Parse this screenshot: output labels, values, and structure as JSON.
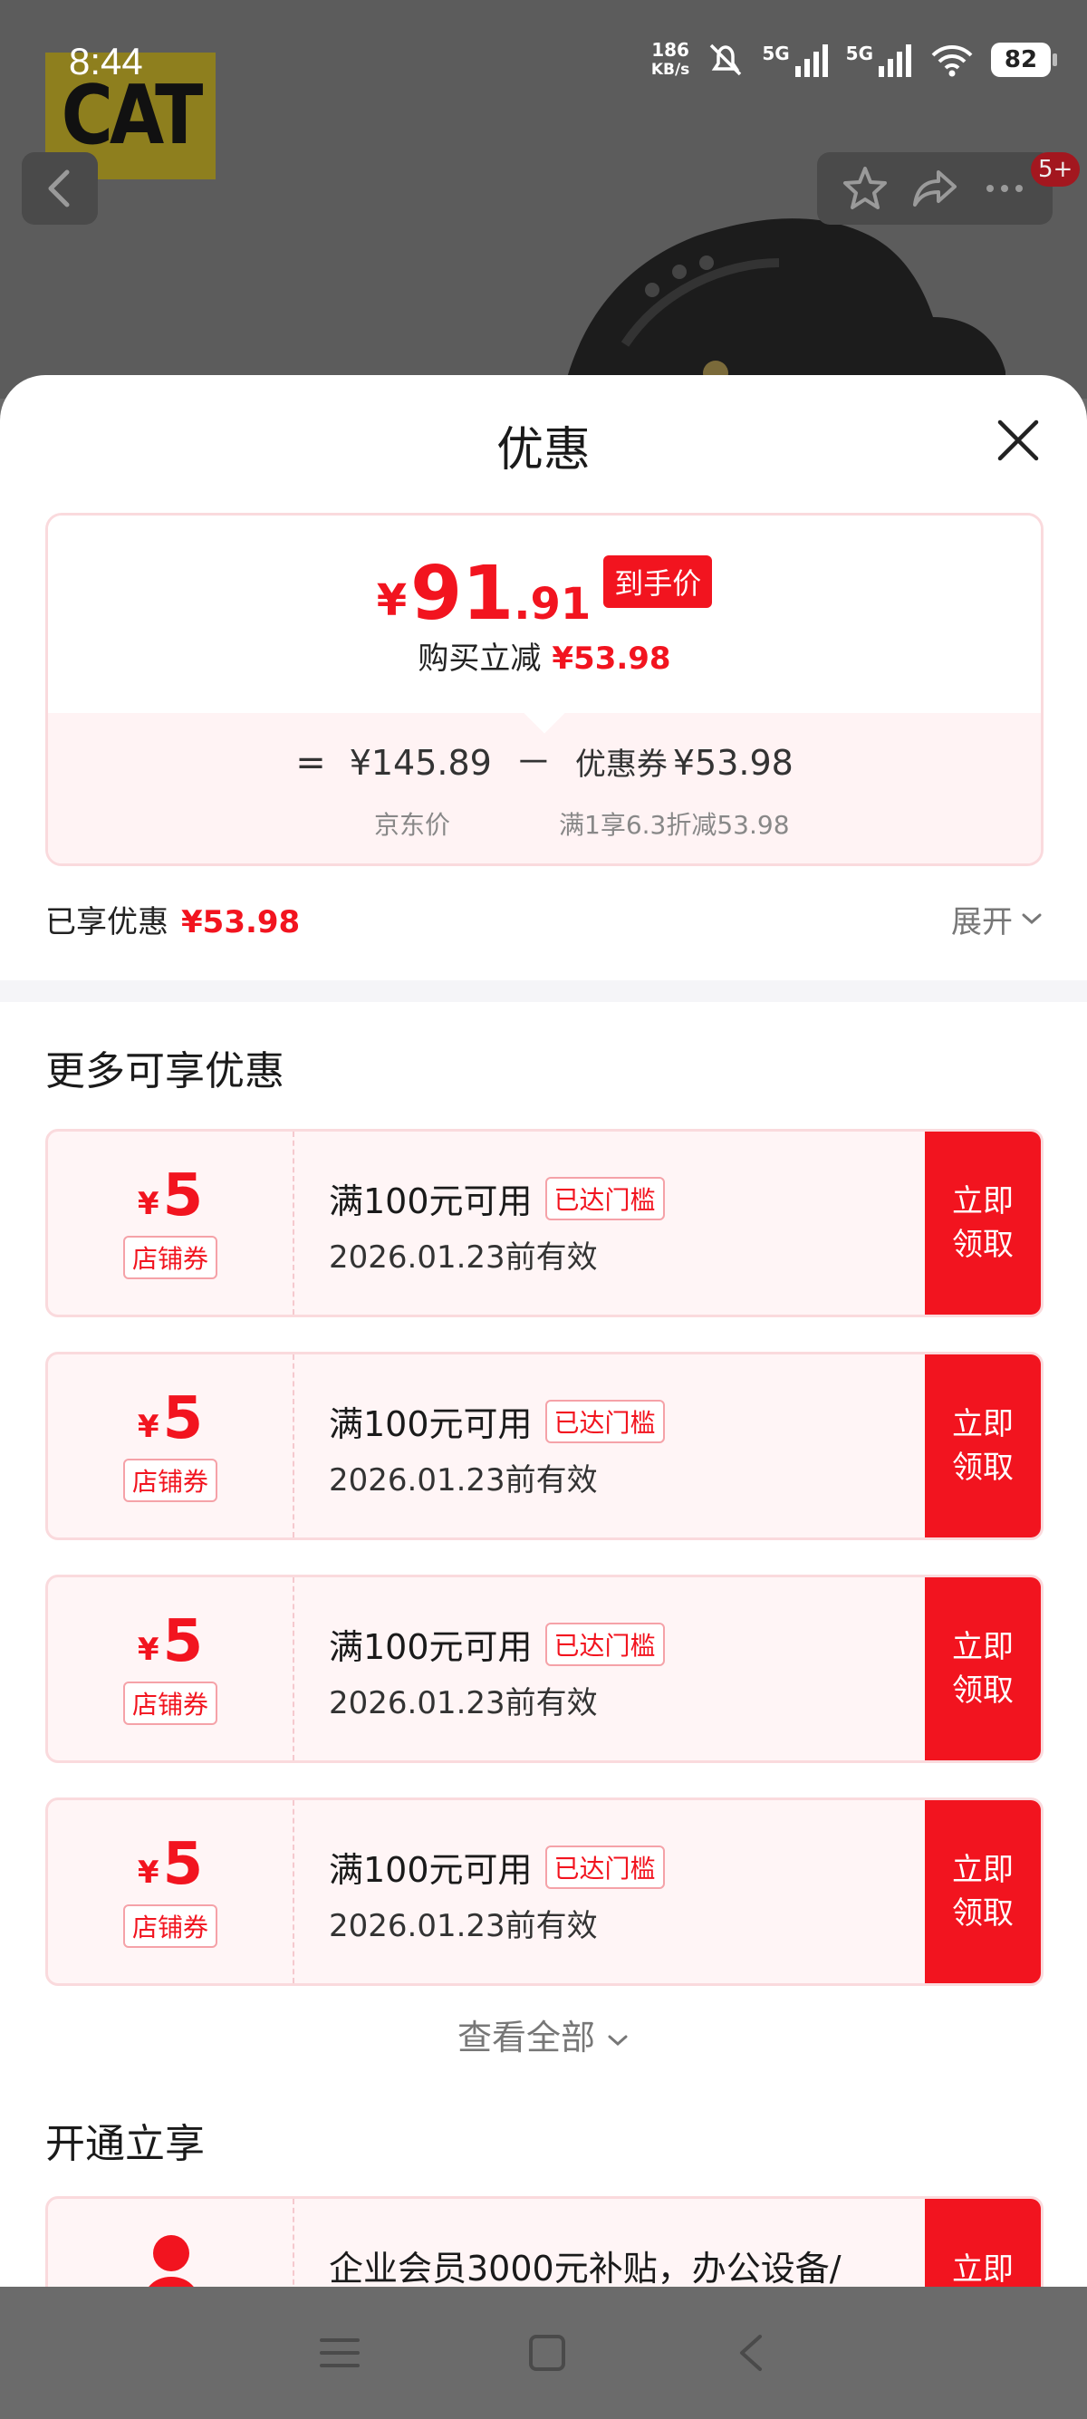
{
  "status_bar": {
    "time": "8:44",
    "net_speed_value": "186",
    "net_speed_unit": "KB/s",
    "sim1": "5G",
    "sim2": "5G",
    "battery": "82"
  },
  "background": {
    "brand_logo_text": "CAT",
    "notification_badge": "5+"
  },
  "sheet": {
    "title": "优惠",
    "price_card": {
      "currency": "¥",
      "price_integer": "91",
      "price_decimal": ".91",
      "final_badge": "到手价",
      "instant_reduce_label": "购买立减",
      "instant_reduce_value": "¥53.98",
      "equals": "=",
      "jd_price": "¥145.89",
      "minus": "－",
      "coupon_label": "优惠券",
      "coupon_value": "¥53.98",
      "jd_price_caption": "京东价",
      "coupon_caption": "满1享6.3折减53.98"
    },
    "enjoyed": {
      "label": "已享优惠",
      "value": "¥53.98",
      "expand_label": "展开"
    },
    "more_section_title": "更多可享优惠",
    "coupons": [
      {
        "currency": "¥",
        "amount": "5",
        "type": "店铺券",
        "condition": "满100元可用",
        "tag": "已达门槛",
        "date": "2026.01.23前有效",
        "button": "立即领取"
      },
      {
        "currency": "¥",
        "amount": "5",
        "type": "店铺券",
        "condition": "满100元可用",
        "tag": "已达门槛",
        "date": "2026.01.23前有效",
        "button": "立即领取"
      },
      {
        "currency": "¥",
        "amount": "5",
        "type": "店铺券",
        "condition": "满100元可用",
        "tag": "已达门槛",
        "date": "2026.01.23前有效",
        "button": "立即领取"
      },
      {
        "currency": "¥",
        "amount": "5",
        "type": "店铺券",
        "condition": "满100元可用",
        "tag": "已达门槛",
        "date": "2026.01.23前有效",
        "button": "立即领取"
      }
    ],
    "view_all_label": "查看全部",
    "open_section_title": "开通立享",
    "member": {
      "text": "企业会员3000元补贴，办公设备/",
      "button": "立即"
    }
  },
  "colors": {
    "accent": "#f2141f",
    "coupon_bg": "#fff5f6",
    "coupon_border": "#fadadd"
  }
}
